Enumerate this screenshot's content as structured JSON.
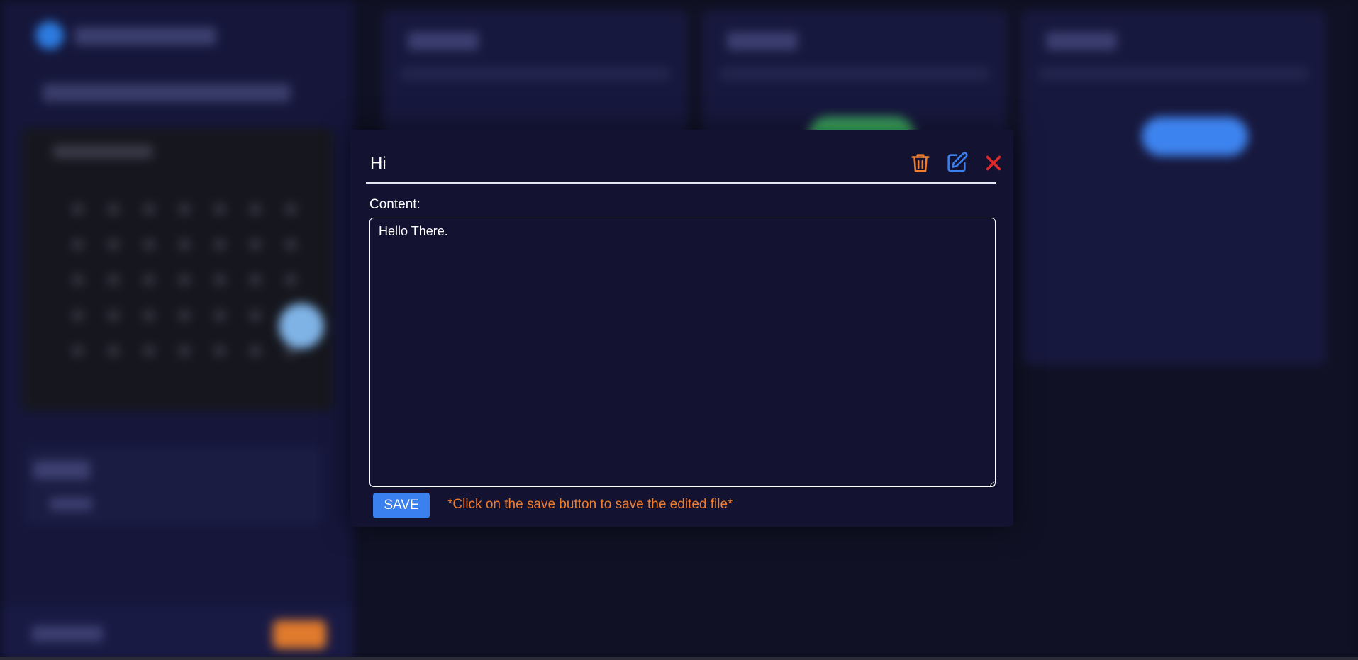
{
  "modal": {
    "title": "Hi",
    "content_label": "Content:",
    "content_value": "Hello There.",
    "save_label": "SAVE",
    "save_hint": "*Click on the save button to save the edited file*",
    "icons": {
      "delete": "trash-icon",
      "edit": "edit-icon",
      "close": "close-icon"
    }
  },
  "colors": {
    "modal_bg": "#131331",
    "save_button": "#3a80ef",
    "hint_text": "#f07d2e",
    "delete_icon": "#f07d2e",
    "edit_icon": "#3a80ef",
    "close_icon": "#e02929"
  }
}
